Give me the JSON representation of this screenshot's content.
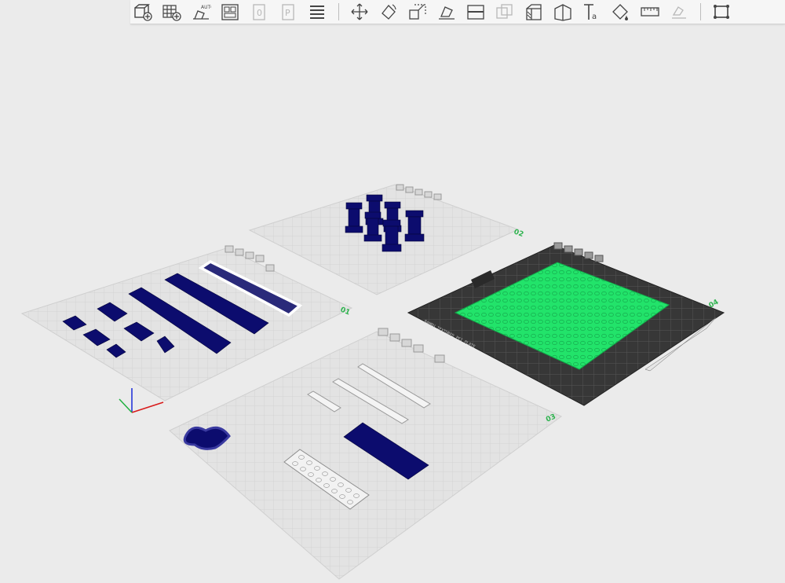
{
  "app": {
    "accent_green": "#22e36a",
    "model_color": "#0c0c6e",
    "selection_outline": "#ffffff"
  },
  "toolbar": {
    "buttons": [
      {
        "icon": "add-object-icon",
        "enabled": true
      },
      {
        "icon": "add-plate-icon",
        "enabled": true
      },
      {
        "icon": "auto-orient-icon",
        "enabled": true
      },
      {
        "icon": "arrange-icon",
        "enabled": true
      },
      {
        "icon": "slice-plate-icon",
        "enabled": false
      },
      {
        "icon": "print-plate-icon",
        "enabled": false
      },
      {
        "icon": "layers-icon",
        "enabled": true
      },
      {
        "icon": "move-icon",
        "enabled": true
      },
      {
        "icon": "rotate-icon",
        "enabled": true
      },
      {
        "icon": "scale-icon",
        "enabled": true
      },
      {
        "icon": "lay-on-face-icon",
        "enabled": true
      },
      {
        "icon": "cut-icon",
        "enabled": true
      },
      {
        "icon": "boolean-icon",
        "enabled": false
      },
      {
        "icon": "support-paint-icon",
        "enabled": true
      },
      {
        "icon": "seam-paint-icon",
        "enabled": true
      },
      {
        "icon": "text-emboss-icon",
        "enabled": true
      },
      {
        "icon": "color-paint-icon",
        "enabled": true
      },
      {
        "icon": "measure-icon",
        "enabled": true
      },
      {
        "icon": "assembly-icon",
        "enabled": false
      },
      {
        "icon": "view-fit-icon",
        "enabled": true
      }
    ]
  },
  "plates": [
    {
      "id": "plate-1",
      "label": "01",
      "objects": 9,
      "selected_objects": 1
    },
    {
      "id": "plate-2",
      "label": "02",
      "objects": 6
    },
    {
      "id": "plate-3",
      "label": "03",
      "objects": 6
    },
    {
      "id": "plate-4",
      "label": "04",
      "objects": 1,
      "active": true,
      "bed_text": "BAMBU TEXTURED PEI PLATE"
    }
  ]
}
